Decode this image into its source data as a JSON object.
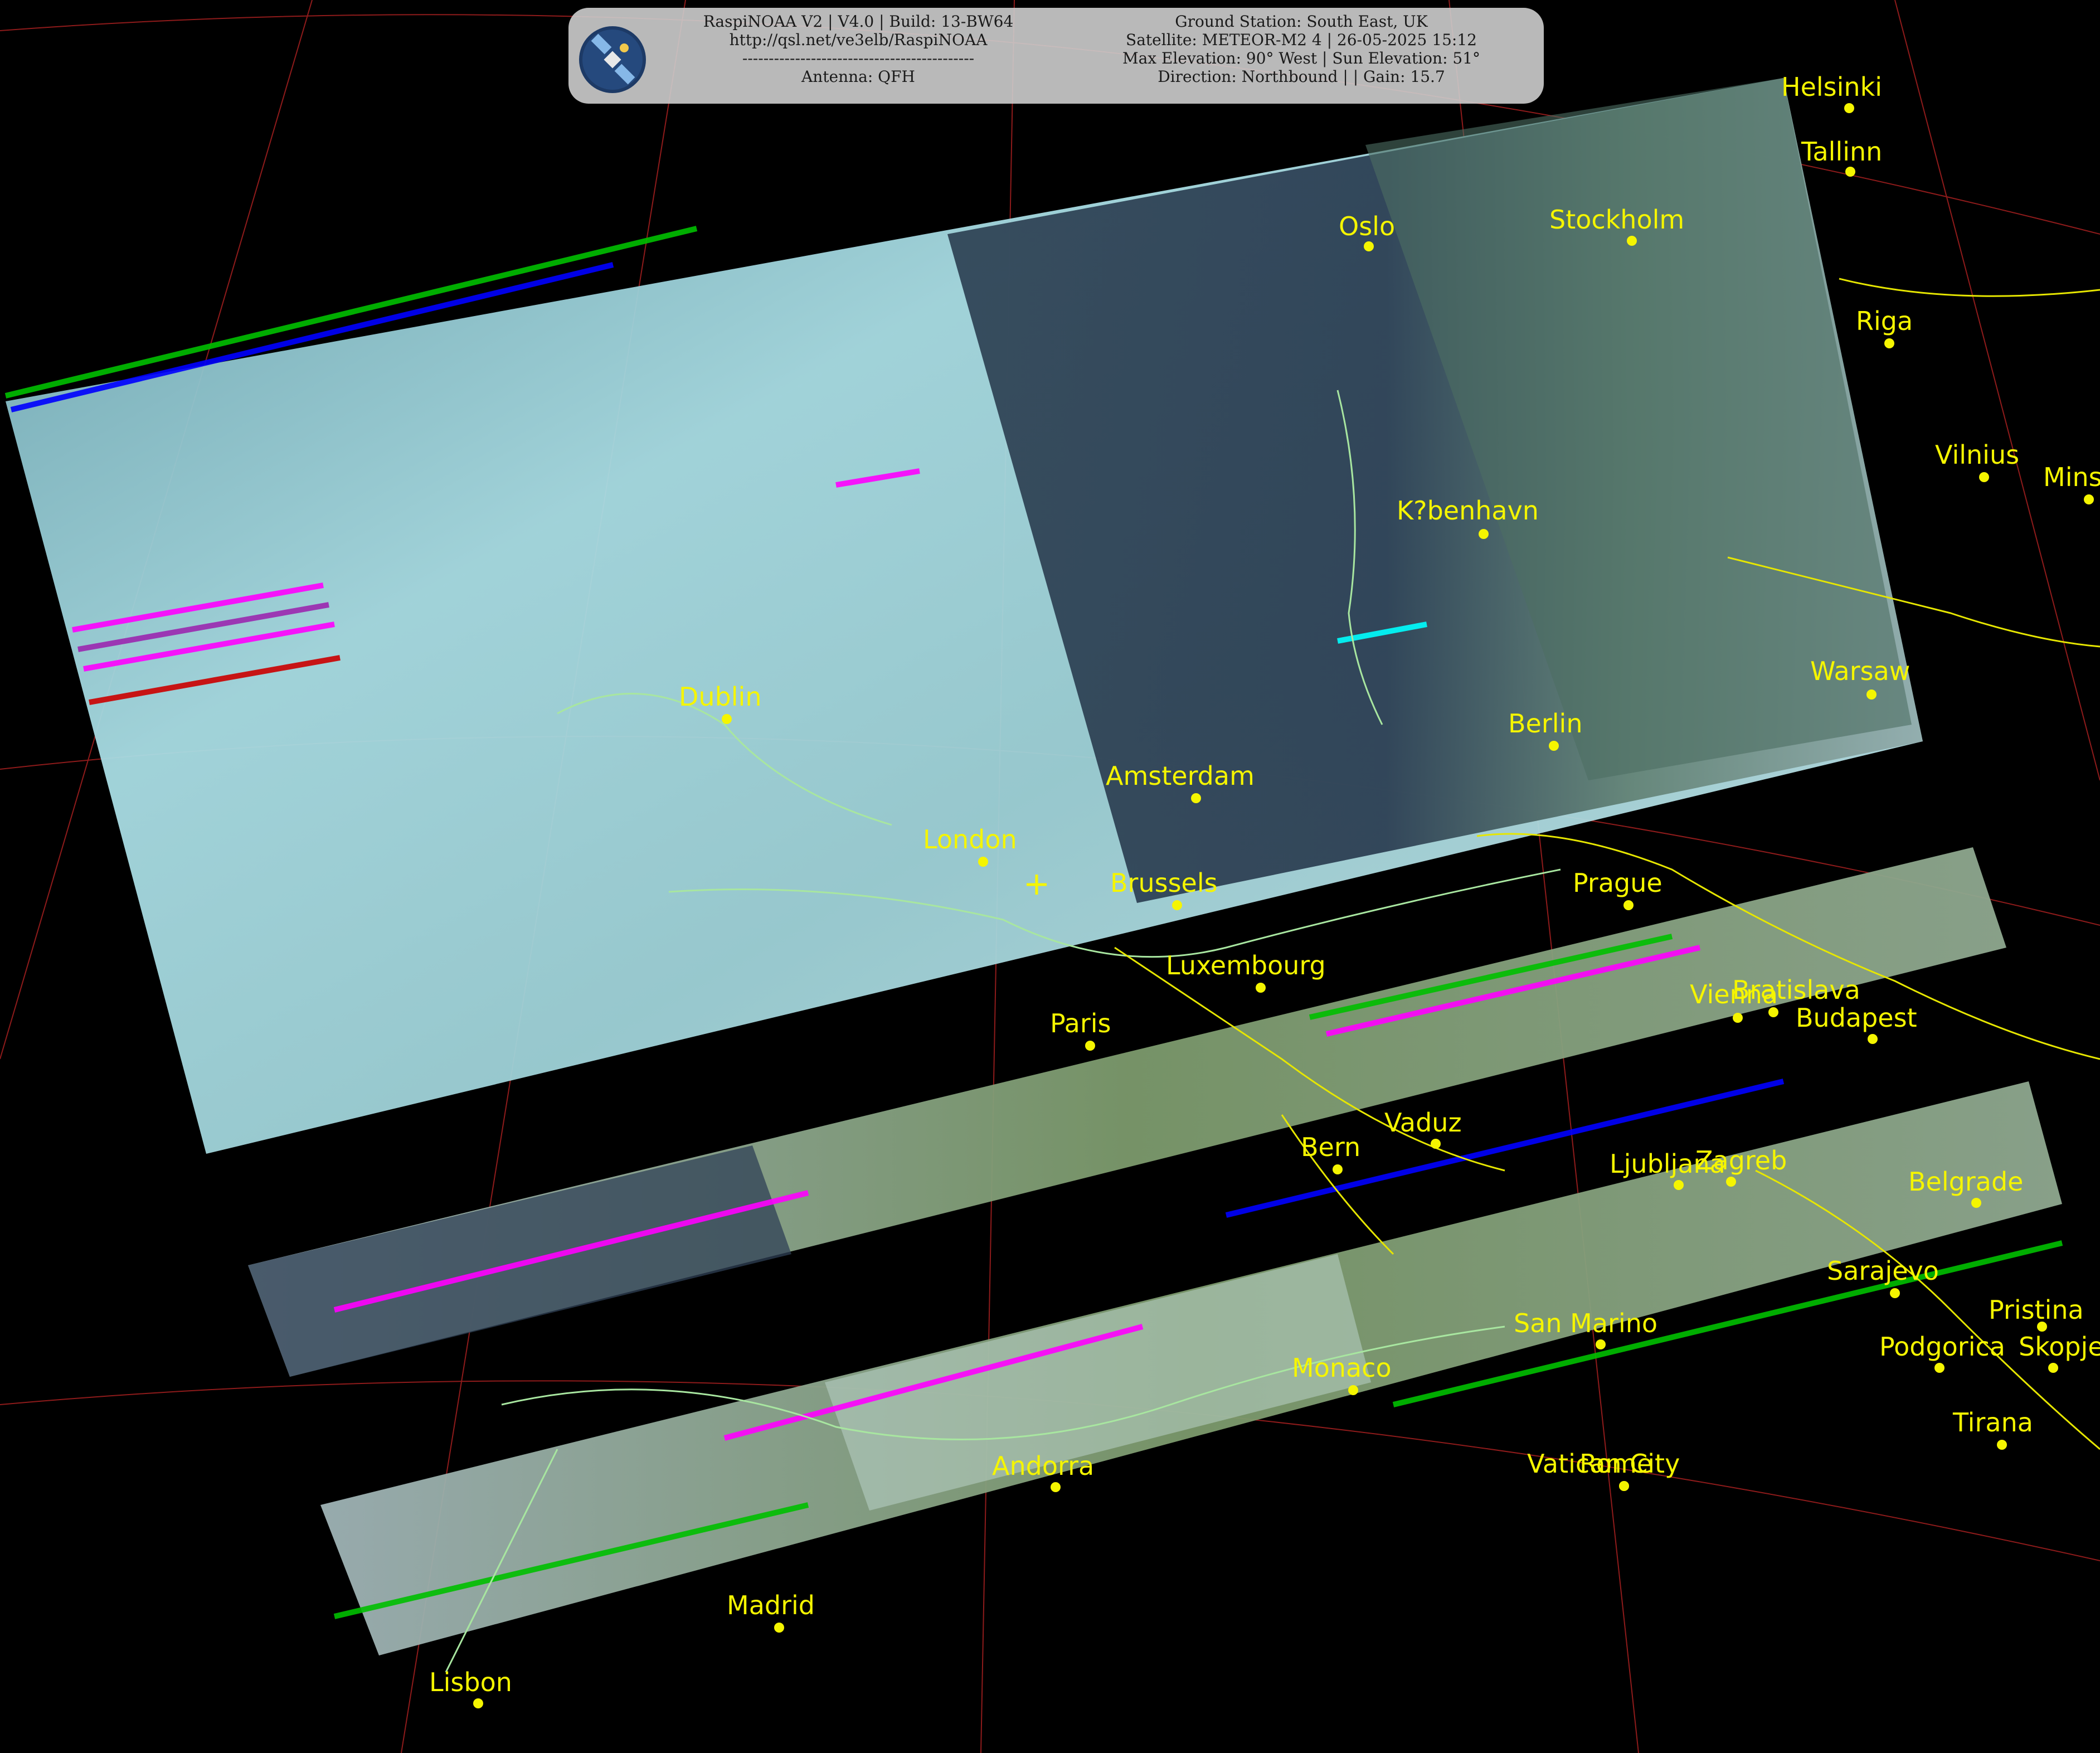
{
  "banner": {
    "logo": "satellite-icon",
    "left_lines": [
      "RaspiNOAA V2 | V4.0 | Build: 13-BW64",
      "http://qsl.net/ve3elb/RaspiNOAA",
      "--------------------------------------------",
      "Antenna: QFH"
    ],
    "right_lines": [
      "Ground Station: South East, UK",
      "Satellite: METEOR-M2 4 | 26-05-2025 15:12",
      "Max Elevation: 90° West | Sun Elevation: 51°",
      "Direction: Northbound | | Gain: 15.7"
    ]
  },
  "colors": {
    "background": "#000000",
    "graticule": "#b22222",
    "borders": "#e6e600",
    "coastline": "#a8e6a0",
    "labels": "#f5f500"
  },
  "cities": [
    {
      "name": "Helsinki"
    },
    {
      "name": "Tallinn"
    },
    {
      "name": "Oslo"
    },
    {
      "name": "Stockholm"
    },
    {
      "name": "Riga"
    },
    {
      "name": "Vilnius"
    },
    {
      "name": "Mins"
    },
    {
      "name": "K?benhavn"
    },
    {
      "name": "Warsaw"
    },
    {
      "name": "Dublin"
    },
    {
      "name": "Berlin"
    },
    {
      "name": "Amsterdam"
    },
    {
      "name": "London"
    },
    {
      "name": "Brussels"
    },
    {
      "name": "Prague"
    },
    {
      "name": "Luxembourg"
    },
    {
      "name": "Vienna"
    },
    {
      "name": "Bratislava"
    },
    {
      "name": "Budapest"
    },
    {
      "name": "Paris"
    },
    {
      "name": "Vaduz"
    },
    {
      "name": "Bern"
    },
    {
      "name": "Ljubljana"
    },
    {
      "name": "Zagreb"
    },
    {
      "name": "Belgrade"
    },
    {
      "name": "Sarajevo"
    },
    {
      "name": "Pristina"
    },
    {
      "name": "San Marino"
    },
    {
      "name": "Podgorica"
    },
    {
      "name": "Skopje"
    },
    {
      "name": "Monaco"
    },
    {
      "name": "Tirana"
    },
    {
      "name": "Vatican City"
    },
    {
      "name": "Rome"
    },
    {
      "name": "Andorra"
    },
    {
      "name": "Madrid"
    },
    {
      "name": "Lisbon"
    }
  ],
  "ground_station_marker": "plus-marker-icon"
}
